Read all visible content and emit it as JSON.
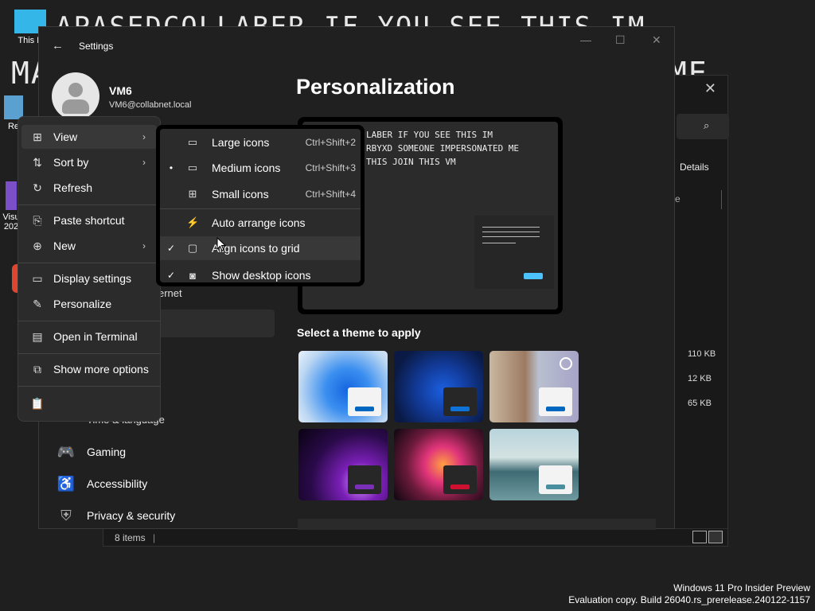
{
  "wallpaper": {
    "line1": "APASEDCOLLABER IF YOU SEE THIS IM",
    "line2": "MA",
    "line2b": "ME"
  },
  "desktop_icons": [
    {
      "label": "This P"
    },
    {
      "label": "Re"
    },
    {
      "label": "Visu\n202"
    }
  ],
  "watermark": {
    "line1": "Windows 11 Pro Insider Preview",
    "line2": "Evaluation copy. Build 26040.rs_prerelease.240122-1157"
  },
  "explorer": {
    "details_label": "Details",
    "sizes": [
      "110 KB",
      "12 KB",
      "65 KB"
    ],
    "status": "8 items",
    "col_fragment": "e"
  },
  "settings": {
    "title": "Settings",
    "user_name": "VM6",
    "user_email": "VM6@collabnet.local",
    "page_title": "Personalization",
    "preview_text": "LABER IF YOU SEE THIS IM\nRBYXD SOMEONE IMPERSONATED ME\nTHIS JOIN THIS VM",
    "theme_label": "Select a theme to apply",
    "nav_fragment": "ernet",
    "nav_fragment2": "Time & language",
    "nav": [
      {
        "label": "Gaming",
        "icon": "gamepad-icon"
      },
      {
        "label": "Accessibility",
        "icon": "accessibility-icon"
      },
      {
        "label": "Privacy & security",
        "icon": "shield-icon"
      }
    ]
  },
  "context_menu": {
    "items": [
      {
        "label": "View",
        "icon": "grid-icon",
        "submenu": true
      },
      {
        "label": "Sort by",
        "icon": "sort-icon",
        "submenu": true
      },
      {
        "label": "Refresh",
        "icon": "refresh-icon",
        "submenu": false
      },
      {
        "label": "Paste shortcut",
        "icon": "paste-shortcut-icon",
        "submenu": false
      },
      {
        "label": "New",
        "icon": "plus-circle-icon",
        "submenu": true
      },
      {
        "label": "Display settings",
        "icon": "display-icon",
        "submenu": false
      },
      {
        "label": "Personalize",
        "icon": "brush-icon",
        "submenu": false
      },
      {
        "label": "Open in Terminal",
        "icon": "terminal-icon",
        "submenu": false
      },
      {
        "label": "Show more options",
        "icon": "more-options-icon",
        "submenu": false
      }
    ],
    "bottom_icon": "clipboard-icon"
  },
  "view_submenu": {
    "items": [
      {
        "label": "Large icons",
        "shortcut": "Ctrl+Shift+2",
        "mark": ""
      },
      {
        "label": "Medium icons",
        "shortcut": "Ctrl+Shift+3",
        "mark": "•"
      },
      {
        "label": "Small icons",
        "shortcut": "Ctrl+Shift+4",
        "mark": ""
      },
      {
        "label": "Auto arrange icons",
        "shortcut": "",
        "mark": ""
      },
      {
        "label": "Align icons to grid",
        "shortcut": "",
        "mark": "✓"
      },
      {
        "label": "Show desktop icons",
        "shortcut": "",
        "mark": "✓"
      }
    ]
  },
  "colors": {
    "accent": "#4cc2ff",
    "menu_bg": "#2b2b2b",
    "window_bg": "#202020"
  }
}
